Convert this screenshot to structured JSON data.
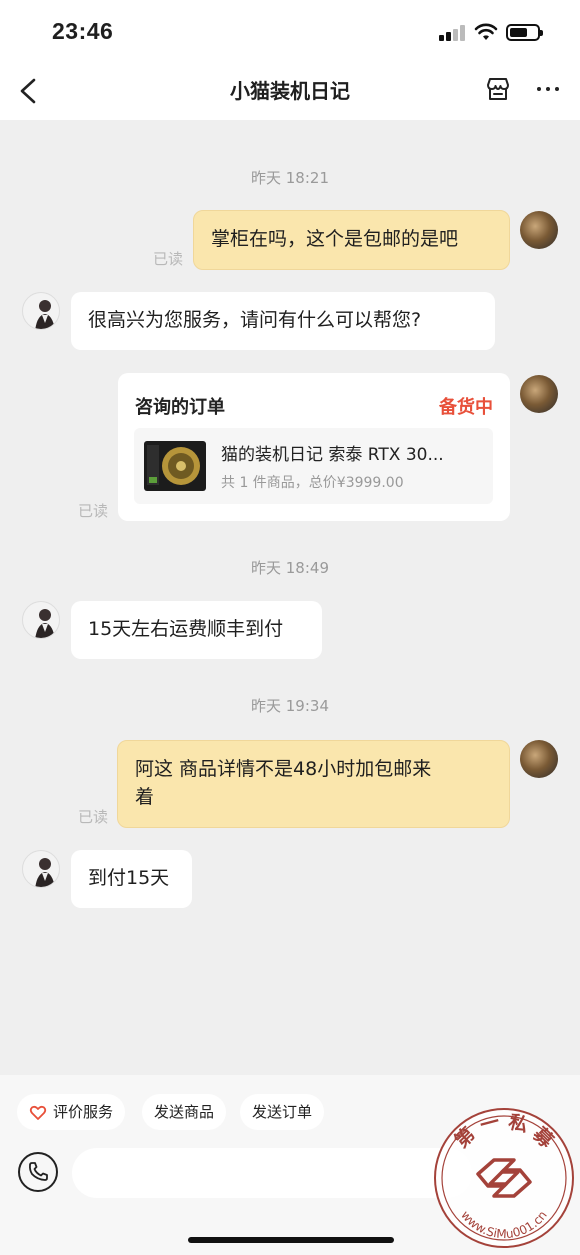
{
  "status_bar": {
    "time": "23:46"
  },
  "header": {
    "title": "小猫装机日记"
  },
  "messages": {
    "ts1": "昨天 18:21",
    "m1": "掌柜在吗，这个是包邮的是吧",
    "read1": "已读",
    "m2": "很高兴为您服务，请问有什么可以帮您?",
    "order_card": {
      "title": "咨询的订单",
      "status": "备货中",
      "product_name": "猫的装机日记 索泰 RTX 30...",
      "summary": "共 1 件商品，总价¥3999.00"
    },
    "read2": "已读",
    "ts2": "昨天 18:49",
    "m3": "15天左右运费顺丰到付",
    "ts3": "昨天 19:34",
    "m4_line1": "阿这 商品详情不是48小时加包邮来",
    "m4_line2": "着",
    "read3": "已读",
    "m5": "到付15天"
  },
  "quick_actions": [
    "评价服务",
    "发送商品",
    "发送订单"
  ],
  "watermark": {
    "top_text": "第 一 私 募",
    "bottom_text": "www.SiMu001.cn"
  },
  "colors": {
    "accent_red": "#e8503a",
    "bubble_mine": "#fae6ad",
    "background": "#efefef"
  },
  "icons": [
    "back-arrow-icon",
    "shop-icon",
    "more-icon",
    "heart-icon",
    "phone-icon"
  ]
}
